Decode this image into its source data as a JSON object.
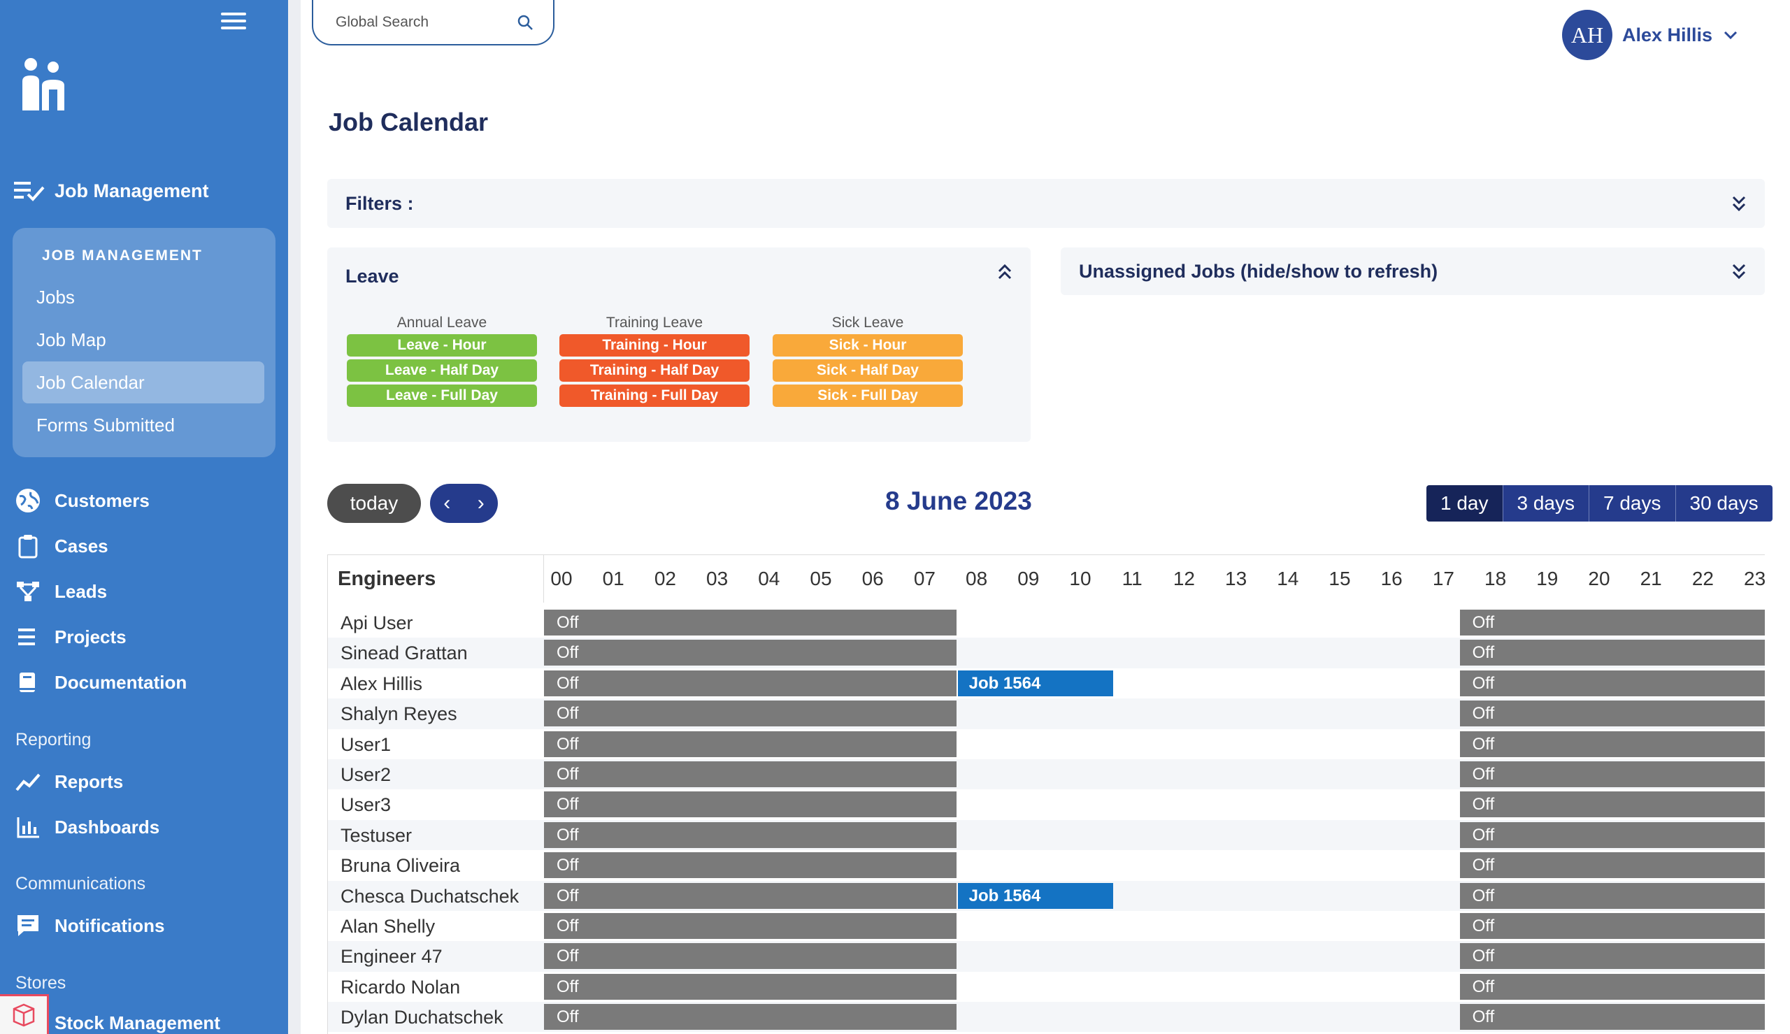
{
  "sidebar": {
    "section_title": "Job Management",
    "sub_caption": "JOB MANAGEMENT",
    "sub_items": [
      "Jobs",
      "Job Map",
      "Job Calendar",
      "Forms Submitted"
    ],
    "items": [
      "Customers",
      "Cases",
      "Leads",
      "Projects",
      "Documentation"
    ],
    "reporting_label": "Reporting",
    "reporting_items": [
      "Reports",
      "Dashboards"
    ],
    "communications_label": "Communications",
    "communications_items": [
      "Notifications"
    ],
    "stores_label": "Stores",
    "stores_items": [
      "Stock Management"
    ]
  },
  "search": {
    "placeholder": "Global Search"
  },
  "user": {
    "initials": "AH",
    "name": "Alex Hillis"
  },
  "page": {
    "title": "Job Calendar"
  },
  "filters": {
    "label": "Filters :"
  },
  "leave": {
    "title": "Leave",
    "columns": [
      {
        "head": "Annual Leave",
        "color": "#7cc242",
        "chips": [
          "Leave - Hour",
          "Leave - Half Day",
          "Leave - Full Day"
        ]
      },
      {
        "head": "Training Leave",
        "color": "#f0592a",
        "chips": [
          "Training - Hour",
          "Training - Half Day",
          "Training - Full Day"
        ]
      },
      {
        "head": "Sick Leave",
        "color": "#f9a93a",
        "chips": [
          "Sick - Hour",
          "Sick - Half Day",
          "Sick - Full Day"
        ]
      }
    ]
  },
  "unassigned": {
    "label": "Unassigned Jobs (hide/show to refresh)"
  },
  "calendar": {
    "today_label": "today",
    "date": "8 June 2023",
    "views": [
      "1 day",
      "3 days",
      "7 days",
      "30 days"
    ],
    "engineers_label": "Engineers",
    "hours": [
      "00",
      "01",
      "02",
      "03",
      "04",
      "05",
      "06",
      "07",
      "08",
      "09",
      "10",
      "11",
      "12",
      "13",
      "14",
      "15",
      "16",
      "17",
      "18",
      "19",
      "20",
      "21",
      "22",
      "23"
    ],
    "off_label": "Off",
    "engineers": [
      {
        "name": "Api User"
      },
      {
        "name": "Sinead Grattan"
      },
      {
        "name": "Alex Hillis",
        "job": "Job 1564"
      },
      {
        "name": "Shalyn Reyes"
      },
      {
        "name": "User1"
      },
      {
        "name": "User2"
      },
      {
        "name": "User3"
      },
      {
        "name": "Testuser"
      },
      {
        "name": "Bruna Oliveira"
      },
      {
        "name": "Chesca Duchatschek",
        "job": "Job 1564"
      },
      {
        "name": "Alan Shelly"
      },
      {
        "name": "Engineer 47"
      },
      {
        "name": "Ricardo Nolan"
      },
      {
        "name": "Dylan Duchatschek"
      }
    ]
  }
}
